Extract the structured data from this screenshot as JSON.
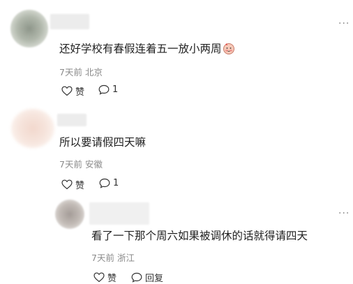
{
  "comments": [
    {
      "text": "还好学校有春假连着五一放小两周",
      "emoji": "face-icon",
      "time": "7天前",
      "location": "北京",
      "like_label": "赞",
      "reply_count": "1"
    },
    {
      "text": "所以要请假四天嘛",
      "time": "7天前",
      "location": "安徽",
      "like_label": "赞",
      "reply_count": "1"
    },
    {
      "text": "看了一下那个周六如果被调休的话就得请四天",
      "time": "7天前",
      "location": "浙江",
      "like_label": "赞",
      "reply_label": "回复"
    }
  ],
  "more_label": "···",
  "colors": {
    "text": "#222222",
    "meta": "#8a8a8a",
    "icon": "#333333"
  }
}
